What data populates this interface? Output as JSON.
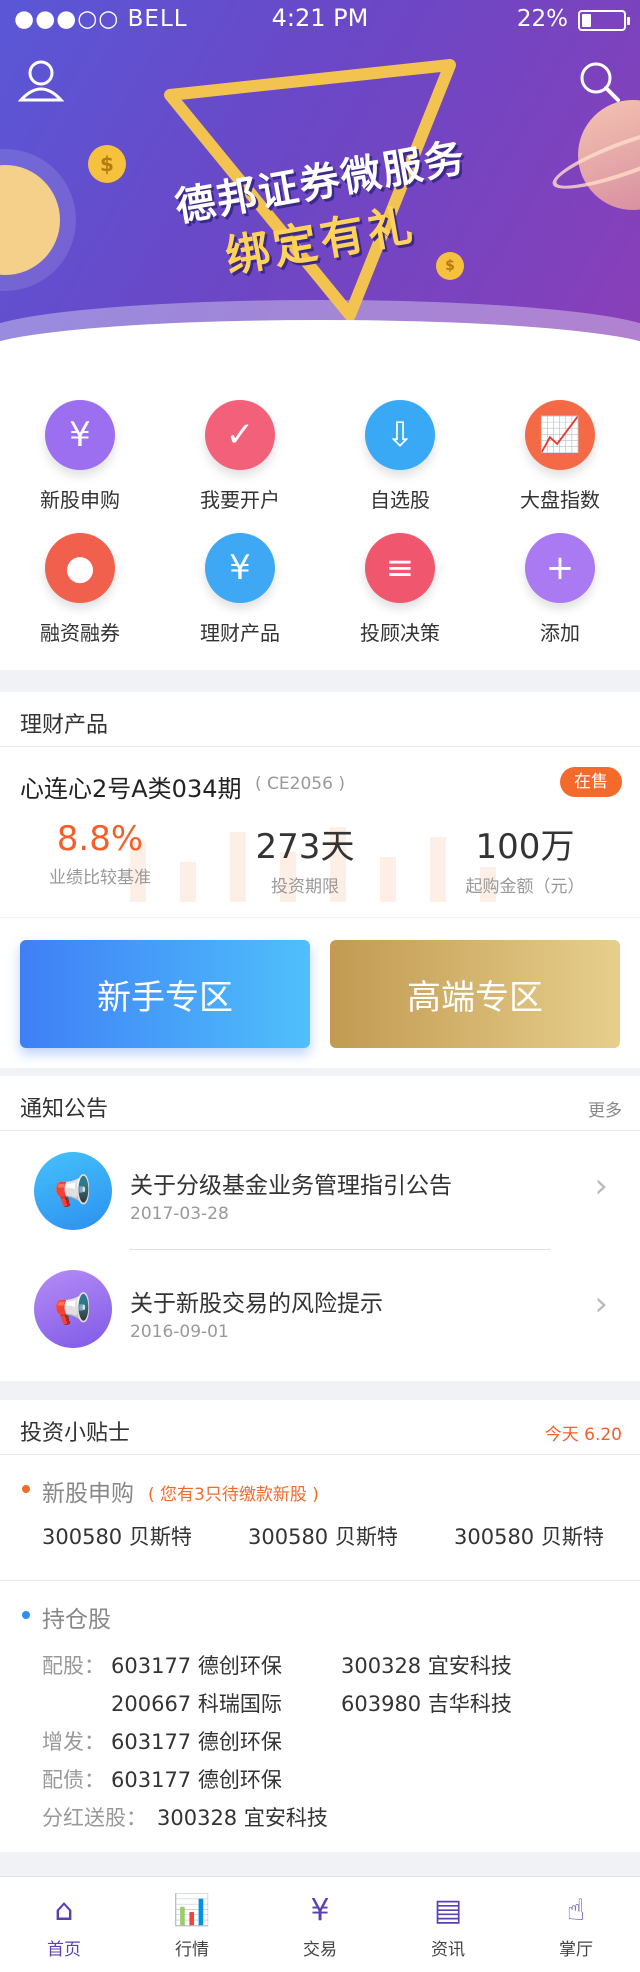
{
  "status_bar": {
    "carrier": "●●●○○ BELL",
    "time": "4:21 PM",
    "battery": "22%",
    "battery_level": 0.22
  },
  "banner": {
    "title": "德邦证券微服务",
    "subtitle": "绑定有礼"
  },
  "quick_menu": [
    {
      "label": "新股申购",
      "icon": "yen-hand-icon",
      "color": "#9b6ff0"
    },
    {
      "label": "我要开户",
      "icon": "clock-check-icon",
      "color": "#f2607a"
    },
    {
      "label": "自选股",
      "icon": "download-box-icon",
      "color": "#39a9f5"
    },
    {
      "label": "大盘指数",
      "icon": "chart-up-icon",
      "color": "#f46a46"
    },
    {
      "label": "融资融券",
      "icon": "drop-icon",
      "color": "#f0604c"
    },
    {
      "label": "理财产品",
      "icon": "wallet-yen-icon",
      "color": "#3ea8f5"
    },
    {
      "label": "投顾决策",
      "icon": "signpost-icon",
      "color": "#f0566e"
    },
    {
      "label": "添加",
      "icon": "plus-icon",
      "color": "#a97af2"
    }
  ],
  "product_section": {
    "title": "理财产品",
    "product_name": "心连心2号A类034期",
    "product_code": "( CE2056 )",
    "badge": "在售",
    "metrics": [
      {
        "value": "8.8%",
        "label": "业绩比较基准"
      },
      {
        "value": "273天",
        "label": "投资期限"
      },
      {
        "value": "100万",
        "label": "起购金额（元）"
      }
    ]
  },
  "zones": {
    "newbie": "新手专区",
    "premium": "高端专区"
  },
  "notices": {
    "title": "通知公告",
    "more": "更多",
    "items": [
      {
        "title": "关于分级基金业务管理指引公告",
        "date": "2017-03-28"
      },
      {
        "title": "关于新股交易的风险提示",
        "date": "2016-09-01"
      }
    ]
  },
  "tips": {
    "title": "投资小贴士",
    "date": "今天 6.20",
    "ipo": {
      "title": "新股申购",
      "note": "( 您有3只待缴款新股 )",
      "stocks": [
        "300580 贝斯特",
        "300580 贝斯特",
        "300580 贝斯特"
      ]
    },
    "holdings": {
      "title": "持仓股",
      "rows": [
        {
          "label": "配股：",
          "items": [
            "603177 德创环保",
            "300328 宜安科技"
          ]
        },
        {
          "label": "",
          "items": [
            "200667 科瑞国际",
            "603980 吉华科技"
          ]
        },
        {
          "label": "增发：",
          "items": [
            "603177 德创环保"
          ]
        },
        {
          "label": "配债：",
          "items": [
            "603177 德创环保"
          ]
        },
        {
          "label": "分红送股：",
          "items": [
            "300328 宜安科技"
          ]
        }
      ]
    }
  },
  "tabs": [
    {
      "label": "首页",
      "icon": "home-icon"
    },
    {
      "label": "行情",
      "icon": "bar-chart-icon"
    },
    {
      "label": "交易",
      "icon": "yen-circle-icon"
    },
    {
      "label": "资讯",
      "icon": "document-icon"
    },
    {
      "label": "掌厅",
      "icon": "tap-hand-icon"
    }
  ]
}
